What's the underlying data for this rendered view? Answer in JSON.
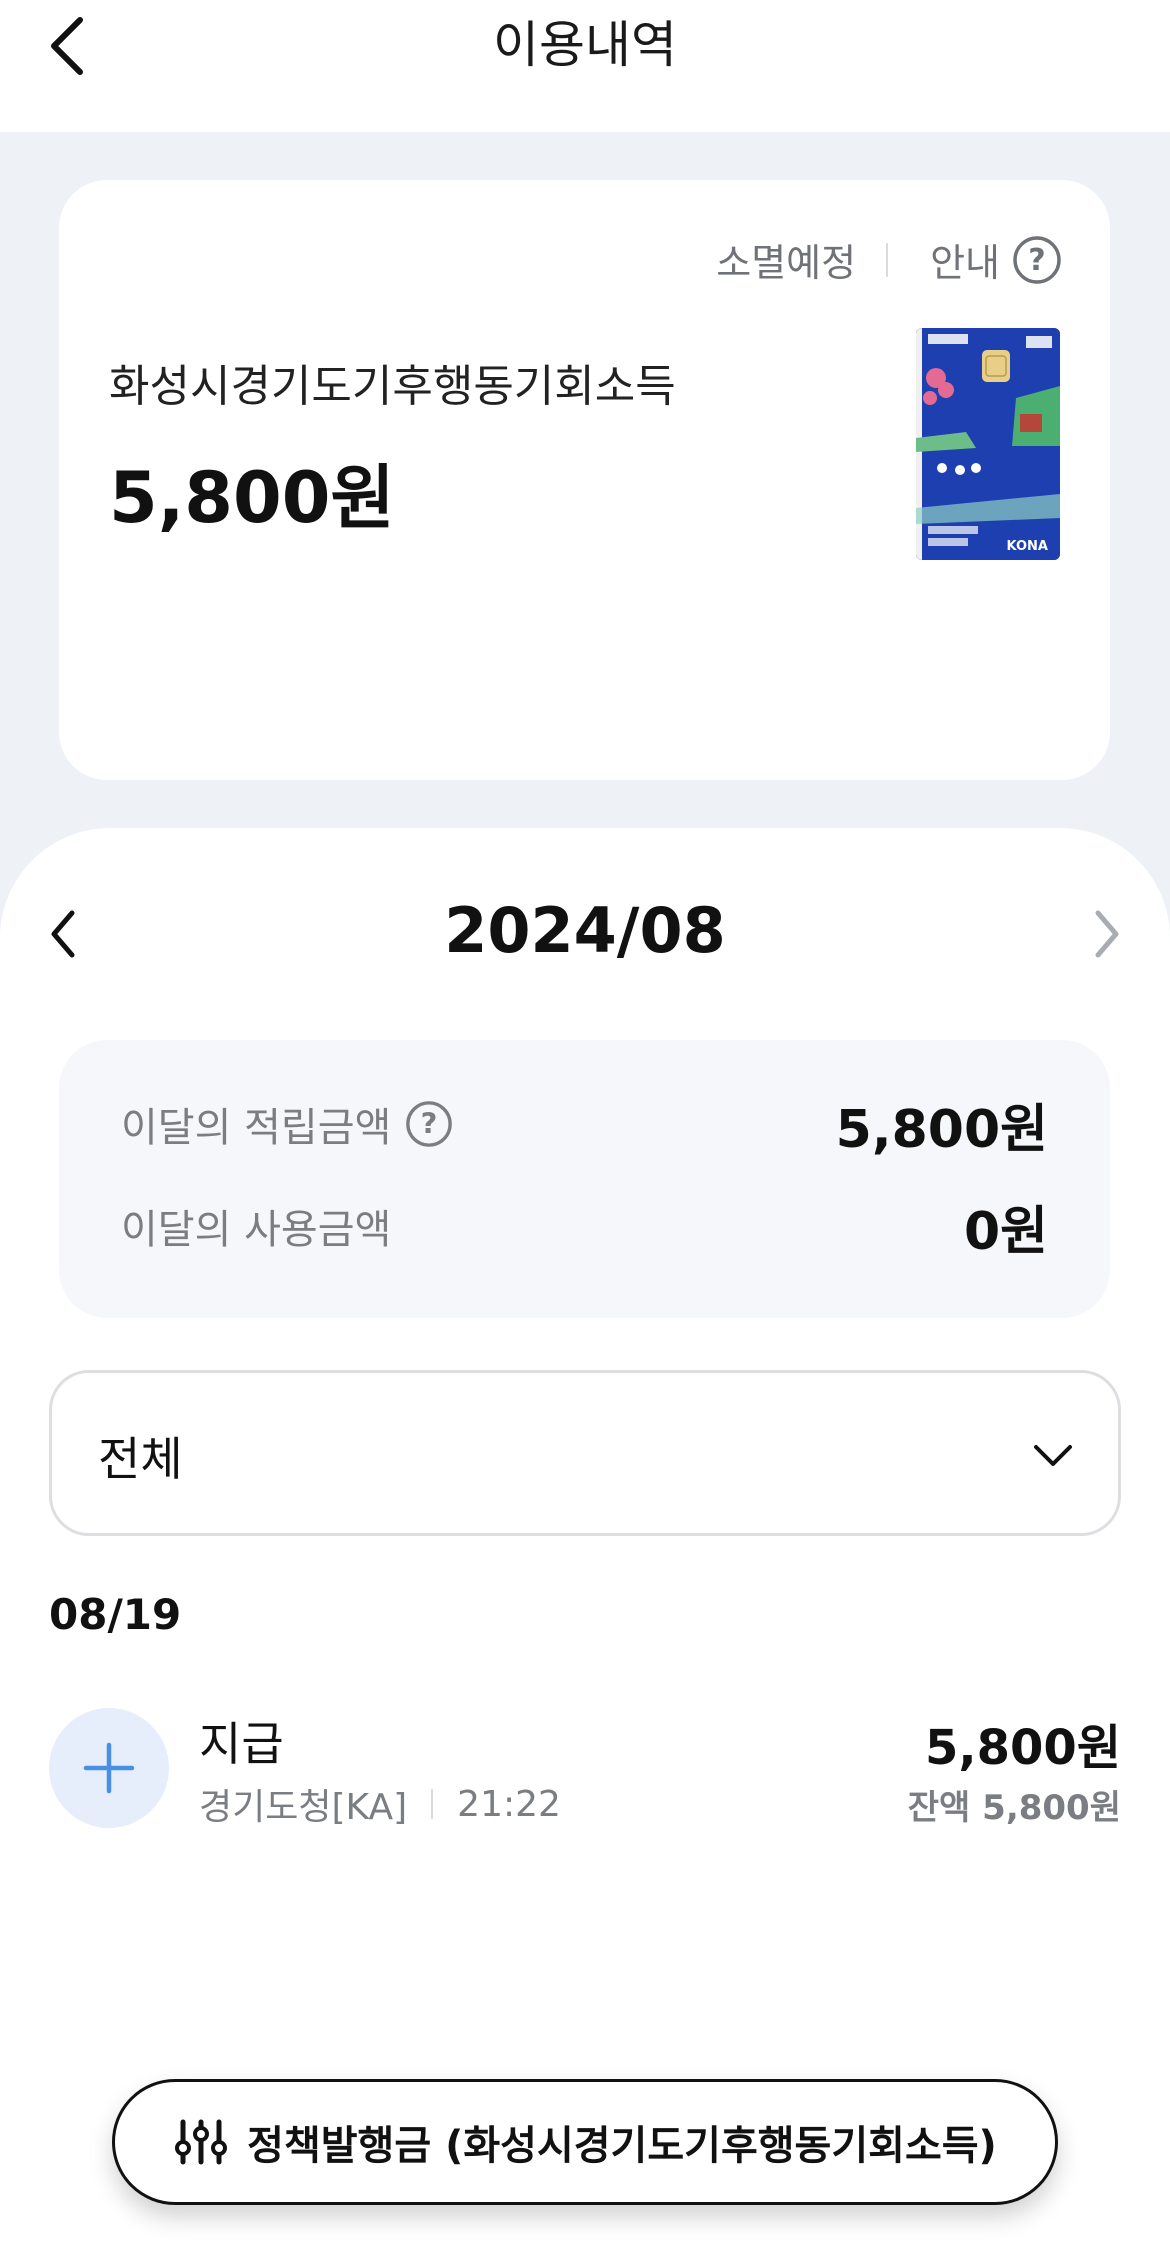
{
  "header": {
    "title": "이용내역"
  },
  "card": {
    "expire_link": "소멸예정",
    "info_link": "안내",
    "name": "화성시경기도기후행동기회소득",
    "amount": "5,800원",
    "card_brand": "KONA"
  },
  "month_nav": {
    "title": "2024/08"
  },
  "summary": {
    "earned_label": "이달의 적립금액",
    "earned_value": "5,800원",
    "used_label": "이달의 사용금액",
    "used_value": "0원"
  },
  "filter": {
    "selected": "전체"
  },
  "transactions": {
    "date": "08/19",
    "items": [
      {
        "title": "지급",
        "merchant": "경기도청[KA]",
        "time": "21:22",
        "amount": "5,800원",
        "balance": "잔액 5,800원"
      }
    ]
  },
  "footer": {
    "policy_button": "정책발행금 (화성시경기도기후행동기회소득)"
  },
  "colors": {
    "accent": "#4a90e2",
    "background": "#eef1f6",
    "card_blue": "#1d3fb0"
  }
}
